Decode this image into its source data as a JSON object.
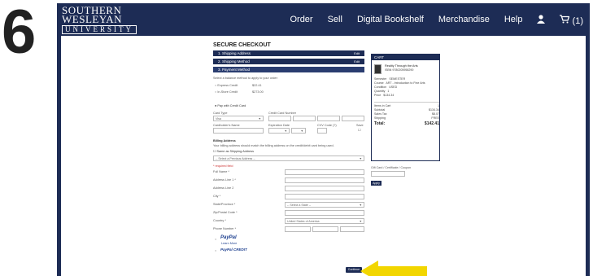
{
  "step_number": "6",
  "logo": {
    "line1": "SOUTHERN",
    "line2": "WESLEYAN",
    "line3": "UNIVERSITY"
  },
  "nav": {
    "items": [
      "Order",
      "Sell",
      "Digital Bookshelf",
      "Merchandise",
      "Help"
    ],
    "cart_label": "(1)"
  },
  "checkout": {
    "title": "SECURE CHECKOUT",
    "steps": [
      {
        "label": "1. Shipping Address",
        "edit": "Edit"
      },
      {
        "label": "2. Shipping Method",
        "edit": "Edit"
      },
      {
        "label": "3. Payment Method",
        "edit": ""
      }
    ],
    "payment_intro": "Select a balance method to apply to your order:",
    "balance_options": [
      {
        "label": "Express Credit",
        "amount": "$22.41"
      },
      {
        "label": "In-Store Credit",
        "amount": "$273.00"
      }
    ],
    "pay_credit_label": "Pay with Credit Card",
    "card_type_label": "Card Type",
    "card_type_value": "Visa",
    "card_number_label": "Credit Card Number",
    "cardholder_label": "Cardholder's Name",
    "expiration_label": "Expiration Date",
    "cvv_label": "CVV Code (?)",
    "save_label": "Save",
    "billing_title": "Billing Address",
    "billing_note": "Your billing address should match the billing address on the credit/debit card being used.",
    "same_as_shipping": "Same as Shipping Address",
    "previous_address": "-- Select a Previous Address --",
    "required_note": "* required field",
    "fields": [
      "Full Name *",
      "Address Line 1 *",
      "Address Line 2",
      "City *",
      "State/Province *",
      "Zip/Postal Code *",
      "Country *",
      "Phone Number *"
    ],
    "state_value": "-- Select a State --",
    "country_value": "United States of America",
    "paypal_label": "PayPal",
    "paypal_learn": "Learn More",
    "paypal_credit": "PayPal CREDIT",
    "continue_label": "Continue"
  },
  "cart": {
    "title": "CART",
    "book_title": "Reality Through the Arts",
    "isbn": "ISBN 9780205958290",
    "details": [
      {
        "k": "Semester",
        "v": "SEMESTER"
      },
      {
        "k": "Course",
        "v": "ART - Introduction to Fine Arts"
      },
      {
        "k": "Condition",
        "v": "USED"
      },
      {
        "k": "Quantity",
        "v": "1"
      },
      {
        "k": "Price",
        "v": "$134.34"
      }
    ],
    "items_label": "Items in Cart",
    "items_count": "1",
    "subtotal_label": "Subtotal",
    "subtotal": "$134.34",
    "tax_label": "Sales Tax",
    "tax": "$8.07",
    "shipping_label": "Shipping",
    "shipping": "FREE",
    "total_label": "Total:",
    "total": "$142.41",
    "giftcard_label": "Gift Card / Certificate / Coupon",
    "apply_label": "Apply"
  }
}
